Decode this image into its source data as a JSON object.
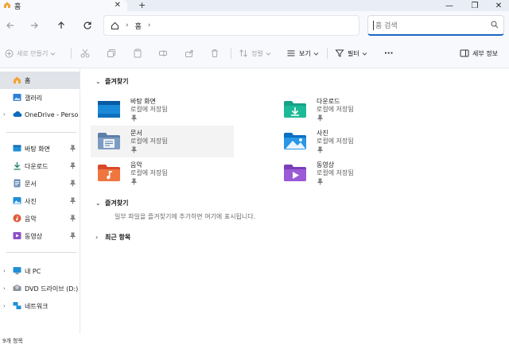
{
  "titlebar": {
    "tab_title": "홈",
    "close_glyph": "✕",
    "new_tab_glyph": "+",
    "minimize_glyph": "—",
    "maximize_glyph": "❐",
    "close_window_glyph": "✕"
  },
  "addressbar": {
    "breadcrumb": "홈",
    "separator": "›",
    "search_placeholder": "홈 검색"
  },
  "commandbar": {
    "new_label": "새로 만들기",
    "sort_label": "정렬",
    "view_label": "보기",
    "filter_label": "필터",
    "more_glyph": "···",
    "details_label": "세부 정보"
  },
  "sidebar": {
    "home": "홈",
    "gallery": "갤러리",
    "onedrive": "OneDrive - Persona",
    "quick": [
      "바탕 화면",
      "다운로드",
      "문서",
      "사진",
      "음악",
      "동영상"
    ],
    "this_pc": "내 PC",
    "dvd": "DVD 드라이브 (D:)",
    "network": "네트워크"
  },
  "main": {
    "favorites_header": "즐겨찾기",
    "tiles": [
      {
        "name": "바탕 화면",
        "sub": "로컬에 저장됨"
      },
      {
        "name": "다운로드",
        "sub": "로컬에 저장됨"
      },
      {
        "name": "문서",
        "sub": "로컬에 저장됨"
      },
      {
        "name": "사진",
        "sub": "로컬에 저장됨"
      },
      {
        "name": "음악",
        "sub": "로컬에 저장됨"
      },
      {
        "name": "동영상",
        "sub": "로컬에 저장됨"
      }
    ],
    "favorites2_header": "즐겨찾기",
    "favorites2_empty": "일부 파일을 즐겨찾기에 추가하면 여기에 표시됩니다.",
    "recent_header": "최근 항목"
  },
  "statusbar": {
    "count": "9개 항목"
  },
  "colors": {
    "accent": "#1a66c5",
    "selected_bg": "#e0e3e8"
  }
}
